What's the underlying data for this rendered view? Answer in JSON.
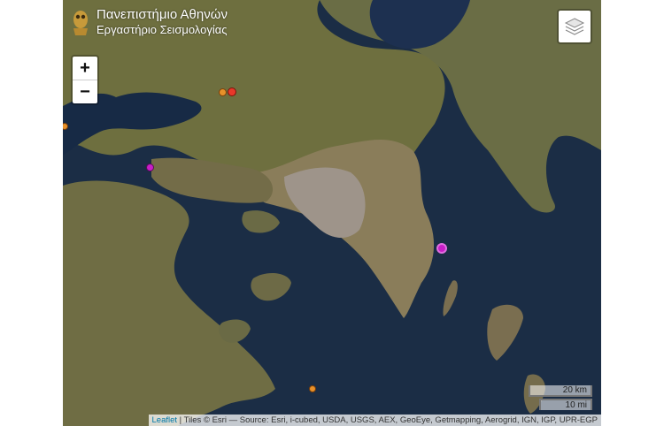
{
  "header": {
    "line1": "Πανεπιστήμιο Αθηνών",
    "line2": "Εργαστήριο Σεισμολογίας"
  },
  "zoom": {
    "in_label": "+",
    "out_label": "−"
  },
  "scale": {
    "km_label": "20 km",
    "mi_label": "10 mi"
  },
  "attribution": {
    "leaflet_link": "Leaflet",
    "text": " | Tiles © Esri — Source: Esri, i-cubed, USDA, USGS, AEX, GeoEye, Getmapping, Aerogrid, IGN, IGP, UPR-EGP"
  },
  "icons": {
    "layers": "layers-icon",
    "logo": "owl-logo-icon"
  },
  "colors": {
    "sea": "#1a2c44",
    "land": "#6b6e3c",
    "marker_orange": "#e8912a",
    "marker_red": "#e8382a",
    "marker_magenta": "#c81ec8"
  }
}
